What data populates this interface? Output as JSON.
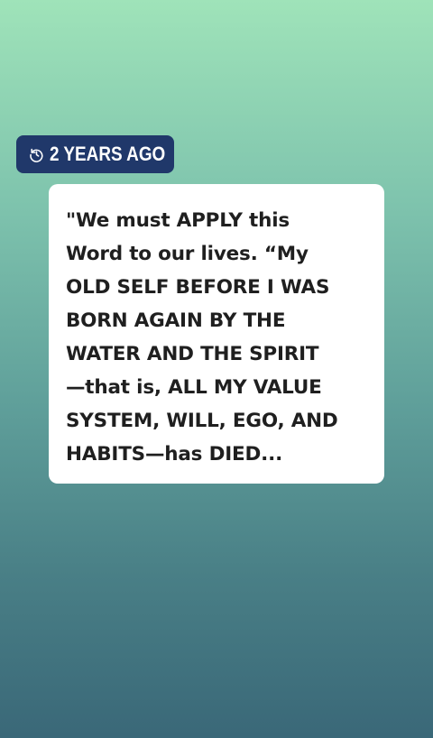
{
  "memory_badge": {
    "icon": "history-clock-icon",
    "label": "2 YEARS AGO",
    "background_color": "#20386a"
  },
  "quote_card": {
    "text": "\"We must APPLY this\nWord to our lives. “My\nOLD SELF BEFORE I WAS\nBORN AGAIN BY THE\nWATER AND THE SPIRIT\n—that is, ALL MY VALUE\nSYSTEM, WILL, EGO, AND\nHABITS—has DIED..."
  },
  "background": {
    "gradient_top": "#9fe3b9",
    "gradient_bottom": "#3a6878"
  }
}
